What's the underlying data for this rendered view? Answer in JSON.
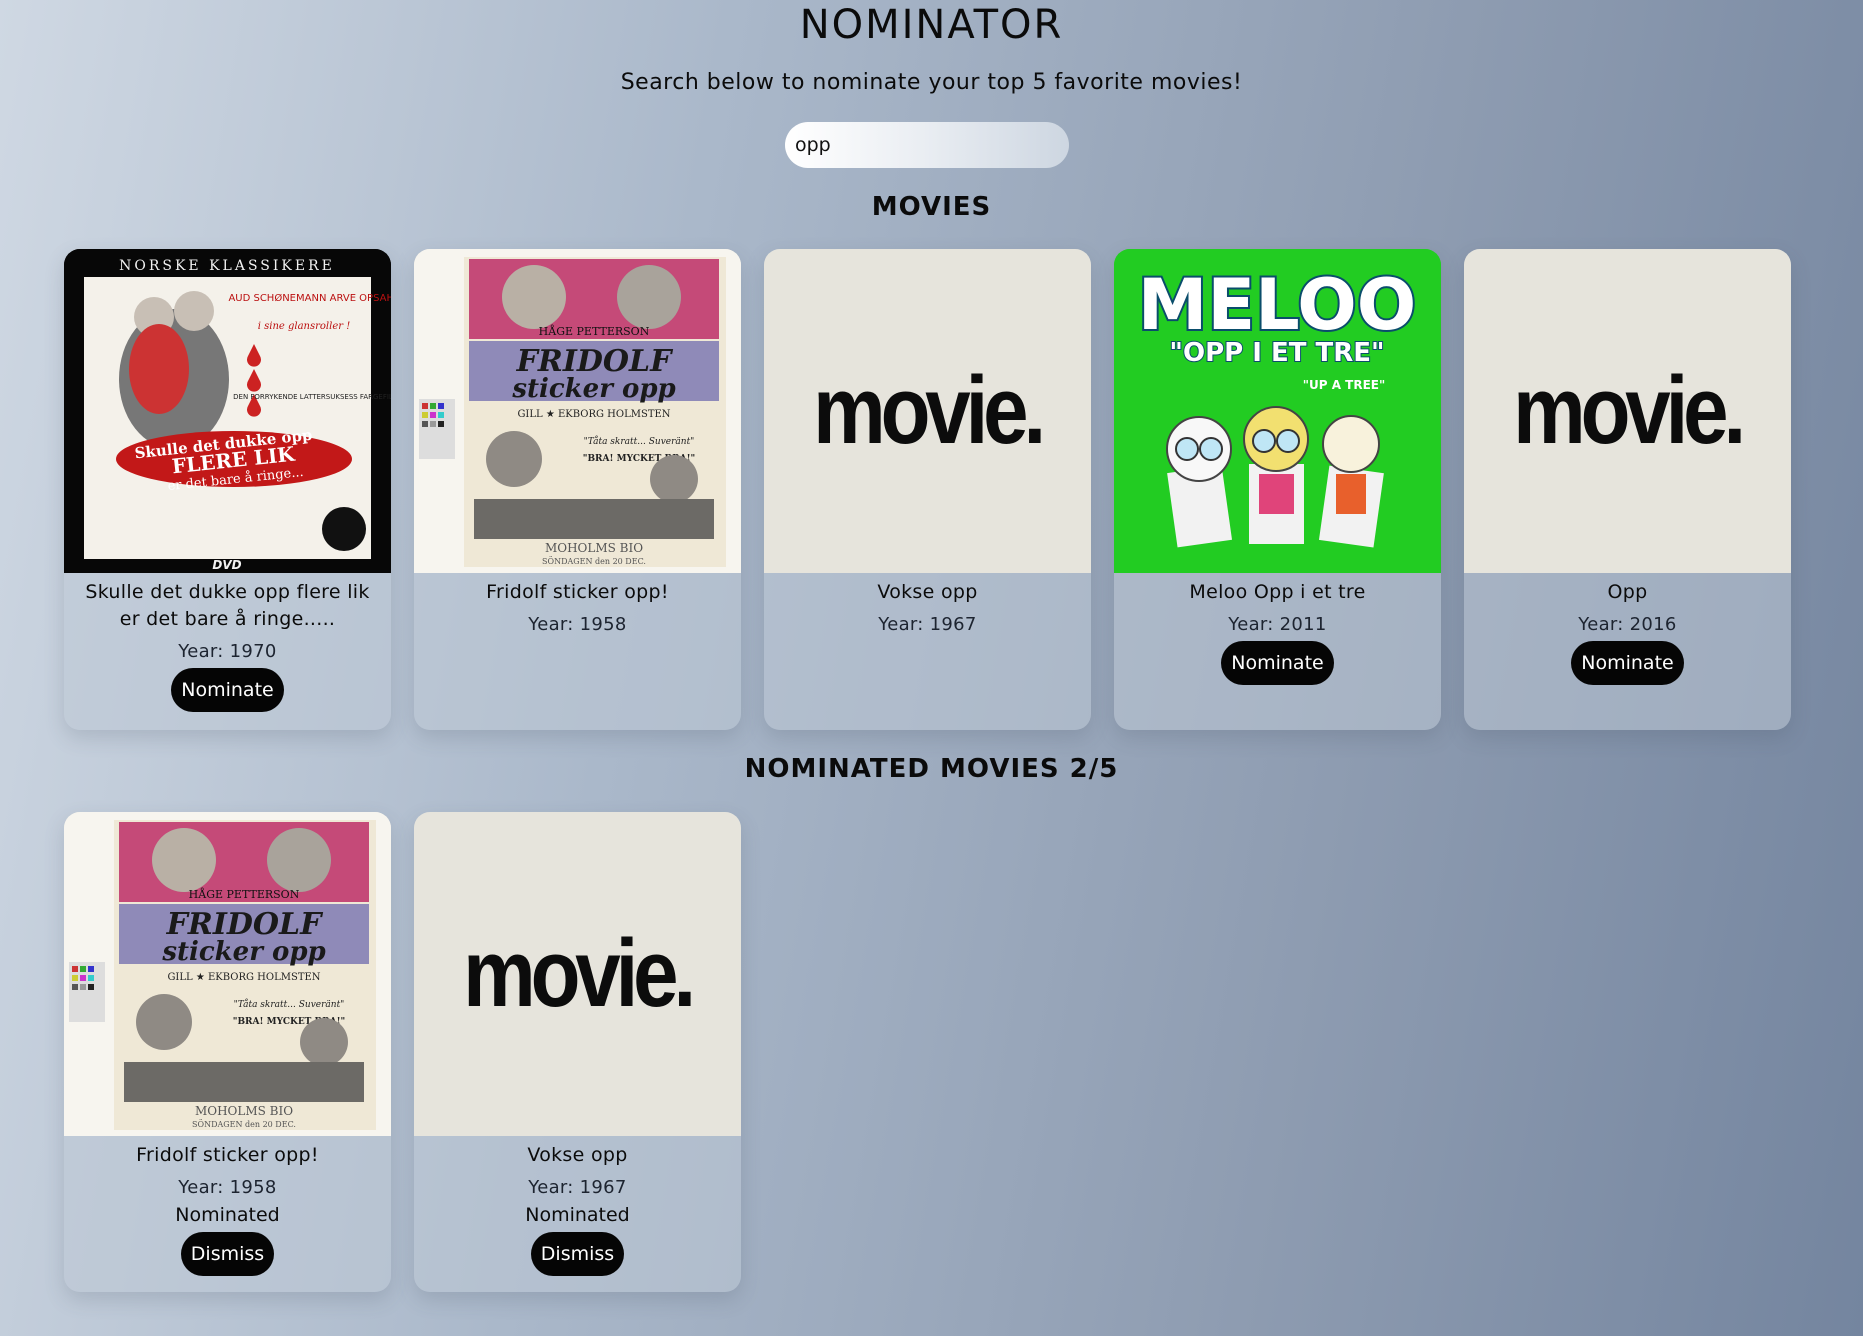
{
  "header": {
    "title": "NOMINATOR",
    "subtitle": "Search below to nominate your top 5 favorite movies!"
  },
  "search": {
    "value": "opp"
  },
  "movies_section": {
    "title": "MOVIES",
    "items": [
      {
        "title": "Skulle det dukke opp flere lik er det bare å ringe.....",
        "year": "Year: 1970",
        "button": "Nominate",
        "poster": "skulle-poster"
      },
      {
        "title": "Fridolf sticker opp!",
        "year": "Year: 1958",
        "button": "",
        "poster": "fridolf-poster"
      },
      {
        "title": "Vokse opp",
        "year": "Year: 1967",
        "button": "",
        "poster": "placeholder-poster"
      },
      {
        "title": "Meloo Opp i et tre",
        "year": "Year: 2011",
        "button": "Nominate",
        "poster": "meloo-poster"
      },
      {
        "title": "Opp",
        "year": "Year: 2016",
        "button": "Nominate",
        "poster": "placeholder-poster"
      }
    ]
  },
  "nominated_section": {
    "title": "NOMINATED MOVIES 2/5",
    "items": [
      {
        "title": "Fridolf sticker opp!",
        "year": "Year: 1958",
        "status": "Nominated",
        "button": "Dismiss",
        "poster": "fridolf-poster"
      },
      {
        "title": "Vokse opp",
        "year": "Year: 1967",
        "status": "Nominated",
        "button": "Dismiss",
        "poster": "placeholder-poster"
      }
    ]
  },
  "posters": {
    "placeholder_text": "movie.",
    "skulle": {
      "top": "NORSKE KLASSIKERE",
      "cast": "AUD SCHØNEMANN ARVE OPSAHL",
      "tag": "i sine glansroller !",
      "note": "DEN FORRYKENDE LATTERSUKSESS FARGEFILMEN:",
      "banner1": "Skulle det dukke opp",
      "banner2": "FLERE LIK",
      "banner3": "er det bare å ringe...",
      "dvd": "DVD"
    },
    "fridolf": {
      "cast": "HÅGE PETTERSON",
      "line1": "FRIDOLF",
      "line2": "sticker opp",
      "cast2": "GILL ★ EKBORG HOLMSTEN",
      "quote1": "\"Tåta skratt... Suveränt\"",
      "quote2": "\"BRA! MYCKET BRA!\"",
      "cinema": "MOHOLMS BIO",
      "date": "SÖNDAGEN den 20 DEC."
    },
    "meloo": {
      "logo": "MELOO",
      "sub": "\"OPP I ET TRE\"",
      "en": "\"UP A TREE\""
    }
  },
  "colors": {
    "button_bg": "#050505",
    "button_text": "#ffffff",
    "meloo_green": "#22cc22"
  }
}
